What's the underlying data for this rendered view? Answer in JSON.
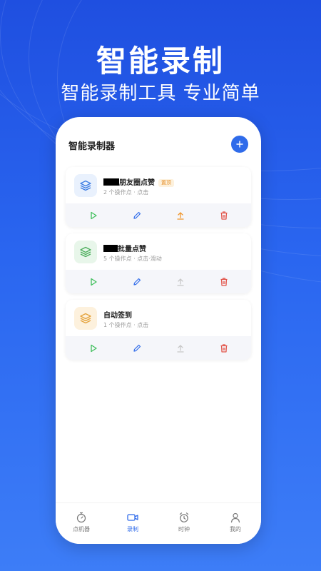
{
  "hero": {
    "title": "智能录制",
    "subtitle": "智能录制工具 专业简单"
  },
  "app": {
    "title": "智能录制器",
    "add_icon": "plus-icon"
  },
  "colors": {
    "accent": "#2f6bea",
    "play": "#3fbf5b",
    "edit": "#2f6bea",
    "upload_active": "#f0962c",
    "upload_disabled": "#c8c8c8",
    "delete": "#e25449"
  },
  "cards": [
    {
      "name_suffix": "朋友圈点赞",
      "tag": "置顶",
      "meta": "2 个操作点 · 点击",
      "icon": "stack-icon",
      "icon_color": "#3d7de4",
      "icon_bg": "#e9f1fd",
      "upload_enabled": true
    },
    {
      "name_suffix": "批量点赞",
      "tag": "",
      "meta": "5 个操作点 · 点击·滑动",
      "icon": "stack-icon",
      "icon_color": "#4cae5b",
      "icon_bg": "#e8f6ea",
      "upload_enabled": false
    },
    {
      "name_suffix": "自动签到",
      "tag": "",
      "meta": "1 个操作点 · 点击",
      "icon": "stack-icon",
      "icon_color": "#e5a23a",
      "icon_bg": "#fdf1dd",
      "upload_enabled": false
    }
  ],
  "tabs": [
    {
      "label": "点机器",
      "icon": "timer-icon",
      "active": false
    },
    {
      "label": "录制",
      "icon": "video-icon",
      "active": true
    },
    {
      "label": "时钟",
      "icon": "alarm-clock-icon",
      "active": false
    },
    {
      "label": "我的",
      "icon": "user-icon",
      "active": false
    }
  ]
}
